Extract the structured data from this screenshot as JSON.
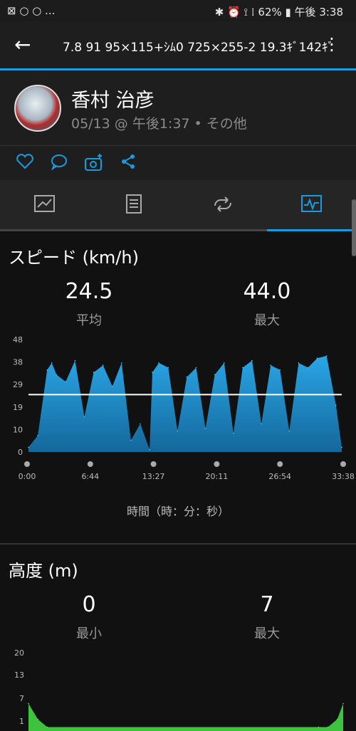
{
  "status": {
    "left": "⊠ ○ ○ ...",
    "right": "✱ ⏰ ⟟ ⁞ 62% ▮ 午後 3:38"
  },
  "appbar": {
    "title": "7.8 91 95×115+ｼﾑ0 725×255-2 19.3ｷﾞ142ｷﾞ"
  },
  "profile": {
    "name": "香村 治彦",
    "meta": "05/13 @ 午後1:37 • その他"
  },
  "speed": {
    "title": "スピード (km/h)",
    "avg": {
      "value": "24.5",
      "label": "平均"
    },
    "max": {
      "value": "44.0",
      "label": "最大"
    },
    "xaxis_title": "時間（時：分：秒）"
  },
  "altitude": {
    "title": "高度 (m)",
    "min": {
      "value": "0",
      "label": "最小"
    },
    "max": {
      "value": "7",
      "label": "最大"
    }
  },
  "colors": {
    "accent": "#1a9be0",
    "speed_fill": "#1f8fcf",
    "alt_fill": "#3ec33e"
  },
  "chart_data": [
    {
      "type": "area",
      "title": "スピード (km/h)",
      "xlabel": "時間（時：分：秒）",
      "ylabel": "",
      "y_ticks": [
        "0",
        "10",
        "19",
        "29",
        "38",
        "48"
      ],
      "x_ticks": [
        "0:00",
        "6:44",
        "13:27",
        "20:11",
        "26:54",
        "33:38"
      ],
      "ylim": [
        0,
        48
      ],
      "xlim": [
        0,
        33.63
      ],
      "average": 24.5,
      "x": [
        0,
        1,
        2,
        2.5,
        3,
        4,
        5,
        6,
        7,
        8,
        9,
        10,
        11,
        12,
        13,
        13.3,
        14,
        15,
        16,
        17,
        18,
        19,
        20,
        21,
        22,
        23,
        24,
        25,
        26,
        27,
        28,
        29,
        30,
        31,
        32,
        33,
        33.63
      ],
      "series": [
        {
          "values": [
            2,
            7,
            35,
            38,
            33,
            30,
            39,
            15,
            34,
            37,
            28,
            38,
            5,
            12,
            1,
            34,
            38,
            36,
            9,
            32,
            36,
            10,
            33,
            38,
            8,
            36,
            39,
            12,
            37,
            35,
            9,
            38,
            36,
            40,
            41,
            20,
            2
          ]
        }
      ]
    },
    {
      "type": "area",
      "title": "高度 (m)",
      "y_ticks": [
        "1",
        "7",
        "13",
        "20"
      ],
      "ylim": [
        0,
        20
      ],
      "x": [
        0,
        1,
        2,
        31,
        32,
        33,
        33.63
      ],
      "series": [
        {
          "values": [
            7,
            3,
            1,
            1,
            1,
            3,
            7
          ]
        }
      ]
    }
  ]
}
